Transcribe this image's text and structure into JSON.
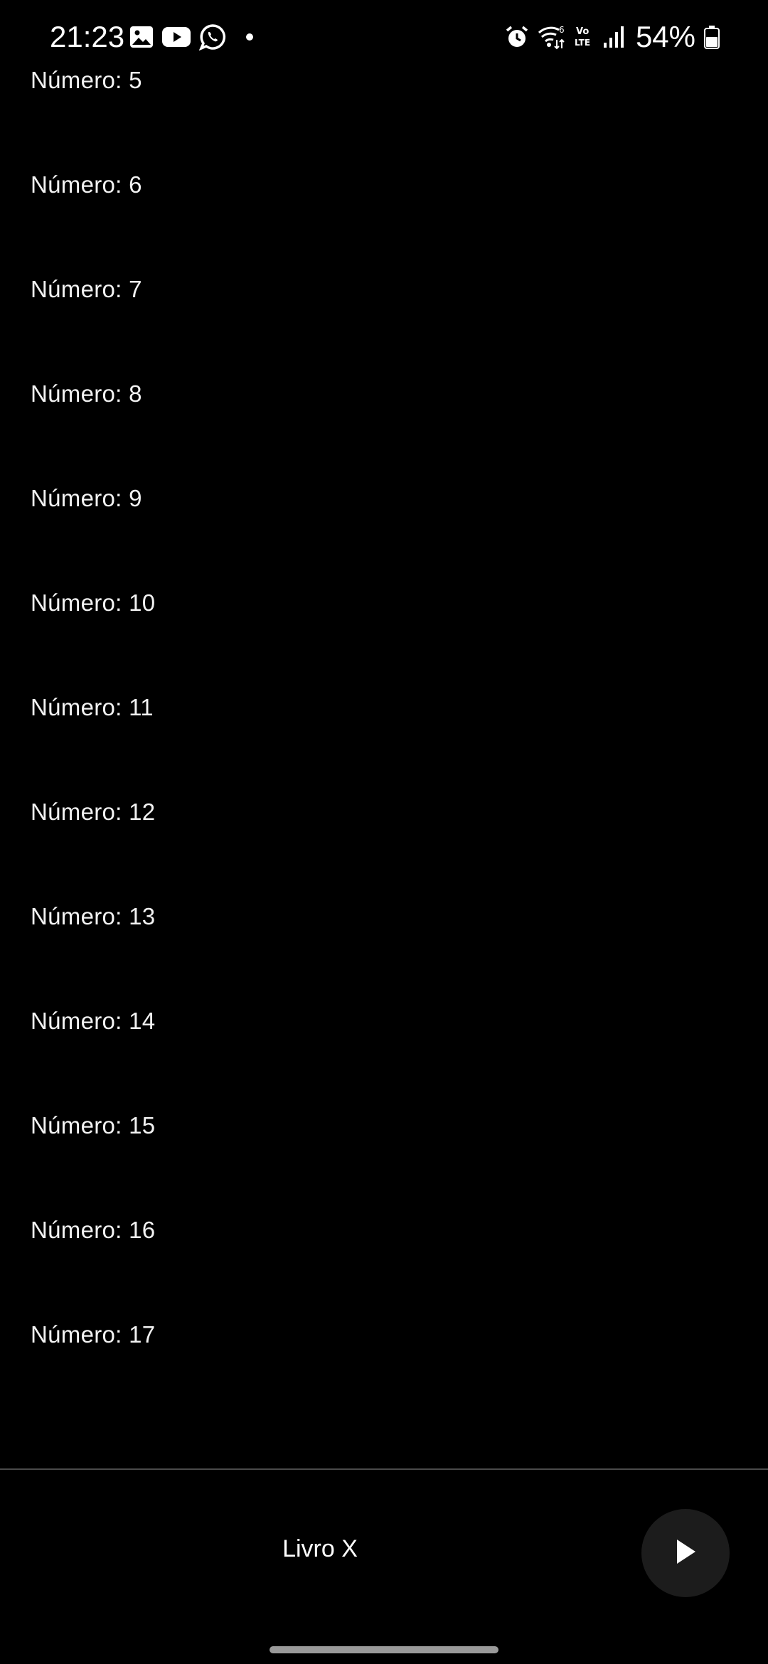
{
  "status_bar": {
    "time": "21:23",
    "battery": "54%",
    "notification_icons": [
      "gallery-icon",
      "youtube-icon",
      "whatsapp-icon",
      "more-notifications-dot"
    ],
    "system_icons": [
      "alarm-icon",
      "wifi-6-icon",
      "volte-icon",
      "signal-icon",
      "battery-icon"
    ]
  },
  "list": {
    "items": [
      "Número: 5",
      "Número: 6",
      "Número: 7",
      "Número: 8",
      "Número: 9",
      "Número: 10",
      "Número: 11",
      "Número: 12",
      "Número: 13",
      "Número: 14",
      "Número: 15",
      "Número: 16",
      "Número: 17"
    ]
  },
  "player": {
    "title": "Livro X",
    "play_icon": "play-icon"
  },
  "colors": {
    "background": "#000000",
    "text": "#ffffff",
    "play_button_bg": "#1c1c1c"
  }
}
